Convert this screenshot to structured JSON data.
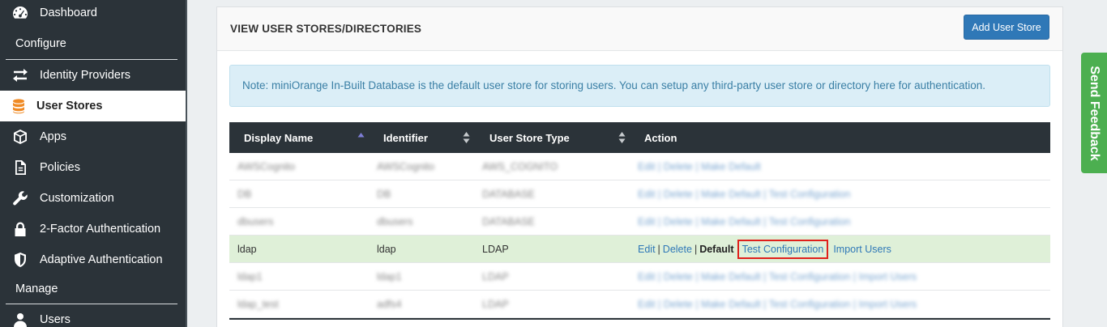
{
  "sidebar": {
    "items": [
      {
        "label": "Dashboard",
        "icon": "dashboard-icon"
      },
      {
        "label": "Identity Providers",
        "icon": "arrows-exchange-icon"
      },
      {
        "label": "User Stores",
        "icon": "database-icon",
        "active": true
      },
      {
        "label": "Apps",
        "icon": "cube-icon"
      },
      {
        "label": "Policies",
        "icon": "document-icon"
      },
      {
        "label": "Customization",
        "icon": "wrench-icon"
      },
      {
        "label": "2-Factor Authentication",
        "icon": "lock-icon"
      },
      {
        "label": "Adaptive Authentication",
        "icon": "shield-icon"
      },
      {
        "label": "Users",
        "icon": "user-icon"
      }
    ],
    "sections": {
      "configure": "Configure",
      "manage": "Manage"
    }
  },
  "panel": {
    "title": "VIEW USER STORES/DIRECTORIES",
    "add_button": "Add User Store",
    "note": "Note: miniOrange In-Built Database is the default user store for storing users. You can setup any third-party user store or directory here for authentication."
  },
  "table": {
    "headers": [
      "Display Name",
      "Identifier",
      "User Store Type",
      "Action"
    ],
    "rows": [
      {
        "display_name": "AWSCognito",
        "identifier": "AWSCognito",
        "type": "AWS_COGNITO",
        "actions": "Edit | Delete | Make Default"
      },
      {
        "display_name": "DB",
        "identifier": "DB",
        "type": "DATABASE",
        "actions": "Edit | Delete | Make Default | Test Configuration"
      },
      {
        "display_name": "dbusers",
        "identifier": "dbusers",
        "type": "DATABASE",
        "actions": "Edit | Delete | Make Default | Test Configuration"
      },
      {
        "display_name": "ldap",
        "identifier": "ldap",
        "type": "LDAP",
        "edit": "Edit",
        "delete": "Delete",
        "default": "Default",
        "test": "Test Configuration",
        "import": "Import Users"
      },
      {
        "display_name": "ldap1",
        "identifier": "ldap1",
        "type": "LDAP",
        "actions": "Edit | Delete | Make Default | Test Configuration | Import Users"
      },
      {
        "display_name": "ldap_test",
        "identifier": "adfs4",
        "type": "LDAP",
        "actions": "Edit | Delete | Make Default | Test Configuration | Import Users"
      }
    ]
  },
  "feedback": {
    "label": "Send Feedback"
  },
  "colors": {
    "sidebar_bg": "#2b3339",
    "accent_blue": "#2f78b7",
    "feedback_green": "#4caf50",
    "highlight_row": "#dff0d8",
    "active_icon": "#f08a24"
  }
}
